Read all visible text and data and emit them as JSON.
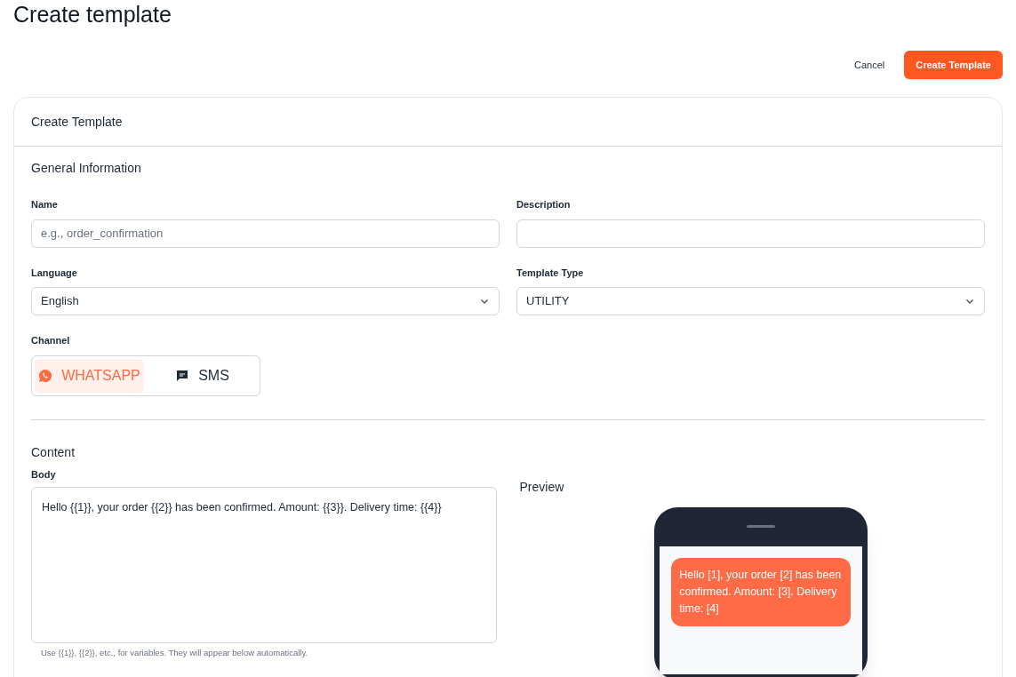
{
  "page_title": "Create template",
  "actions": {
    "cancel": "Cancel",
    "submit": "Create Template"
  },
  "card": {
    "title": "Create Template",
    "general": {
      "heading": "General Information",
      "fields": [
        {
          "kind": "input",
          "label": "Name",
          "placeholder": "e.g., order_confirmation"
        },
        {
          "kind": "input",
          "label": "Description"
        },
        {
          "kind": "select",
          "label": "Language",
          "value": "English"
        },
        {
          "kind": "select",
          "label": "Template Type",
          "value": "UTILITY"
        }
      ],
      "channel": {
        "label": "Channel",
        "options": [
          {
            "kind": "whatsapp",
            "label": "WHATSAPP",
            "selected": true
          },
          {
            "kind": "sms",
            "label": "SMS",
            "selected": false
          }
        ]
      }
    },
    "content": {
      "heading": "Content",
      "body_label": "Body",
      "body_value": "Hello {{1}}, your order {{2}} has been confirmed. Amount: {{3}}. Delivery time: {{4}}",
      "hint": "Use {{1}}, {{2}}, etc., for variables. They will appear below automatically.",
      "preview_label": "Preview",
      "preview_message": "Hello [1], your order [2] has been confirmed. Amount: [3]. Delivery time: [4]"
    }
  }
}
